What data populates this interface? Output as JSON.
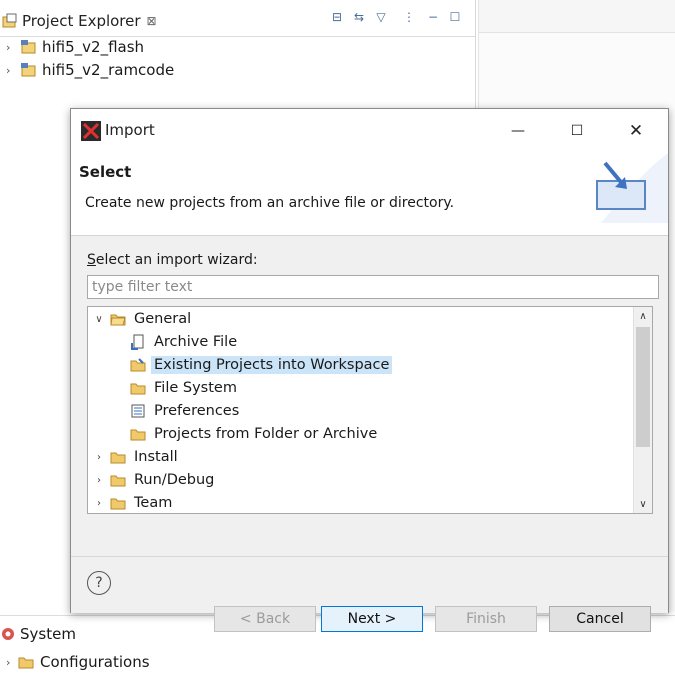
{
  "project_explorer": {
    "tab_title": "Project Explorer",
    "close_glyph": "⊠",
    "projects": [
      {
        "label": "hifi5_v2_flash"
      },
      {
        "label": "hifi5_v2_ramcode"
      }
    ]
  },
  "bottom": {
    "tab_label": "System",
    "tree_item": "Configurations"
  },
  "dialog": {
    "title": "Import",
    "banner_heading": "Select",
    "banner_description": "Create new projects from an archive file or directory.",
    "wizard_label_mnemonic": "S",
    "wizard_label_rest": "elect an import wizard:",
    "filter_placeholder": "type filter text",
    "filter_value": "",
    "tree": [
      {
        "label": "General",
        "expanded": true,
        "level": 0
      },
      {
        "label": "Archive File",
        "level": 1
      },
      {
        "label": "Existing Projects into Workspace",
        "level": 1,
        "selected": true
      },
      {
        "label": "File System",
        "level": 1
      },
      {
        "label": "Preferences",
        "level": 1
      },
      {
        "label": "Projects from Folder or Archive",
        "level": 1
      },
      {
        "label": "Install",
        "expanded": false,
        "level": 0
      },
      {
        "label": "Run/Debug",
        "expanded": false,
        "level": 0
      },
      {
        "label": "Team",
        "expanded": false,
        "level": 0
      }
    ],
    "buttons": {
      "back": "< Back",
      "next": "Next >",
      "finish": "Finish",
      "cancel": "Cancel"
    },
    "help_glyph": "?"
  },
  "colors": {
    "selection": "#cce4f7",
    "folder": "#e8b84a",
    "default_button_border": "#0078d7"
  }
}
